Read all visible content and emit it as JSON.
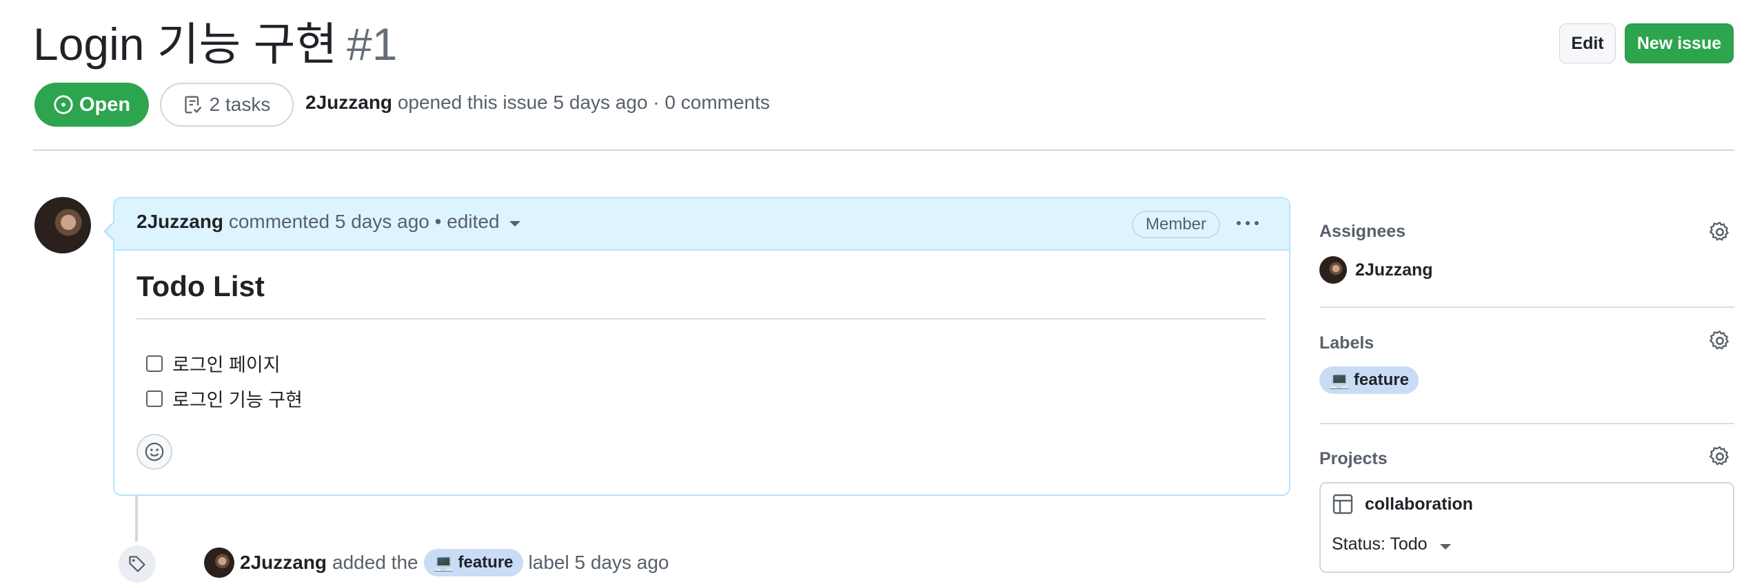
{
  "issue": {
    "title": "Login 기능 구현",
    "number": "#1",
    "status": "Open",
    "tasks": "2 tasks",
    "author": "2Juzzang",
    "meta_text": "opened this issue 5 days ago · 0 comments"
  },
  "header": {
    "edit_label": "Edit",
    "new_issue_label": "New issue"
  },
  "comment": {
    "author": "2Juzzang",
    "meta": "commented 5 days ago",
    "edited": "• edited",
    "role_badge": "Member",
    "body_title": "Todo List",
    "tasks": [
      {
        "label": "로그인 페이지",
        "checked": false
      },
      {
        "label": "로그인 기능 구현",
        "checked": false
      }
    ]
  },
  "timeline": {
    "event_author": "2Juzzang",
    "event_added": "added the",
    "event_label": "feature",
    "event_suffix": "label 5 days ago"
  },
  "sidebar": {
    "assignees_title": "Assignees",
    "assignee": "2Juzzang",
    "labels_title": "Labels",
    "label": "feature",
    "projects_title": "Projects",
    "project_name": "collaboration",
    "project_status": "Status: Todo"
  },
  "colors": {
    "open_green": "#2da44e",
    "comment_header": "#ddf4ff",
    "label_bg": "#c9dcf5"
  }
}
